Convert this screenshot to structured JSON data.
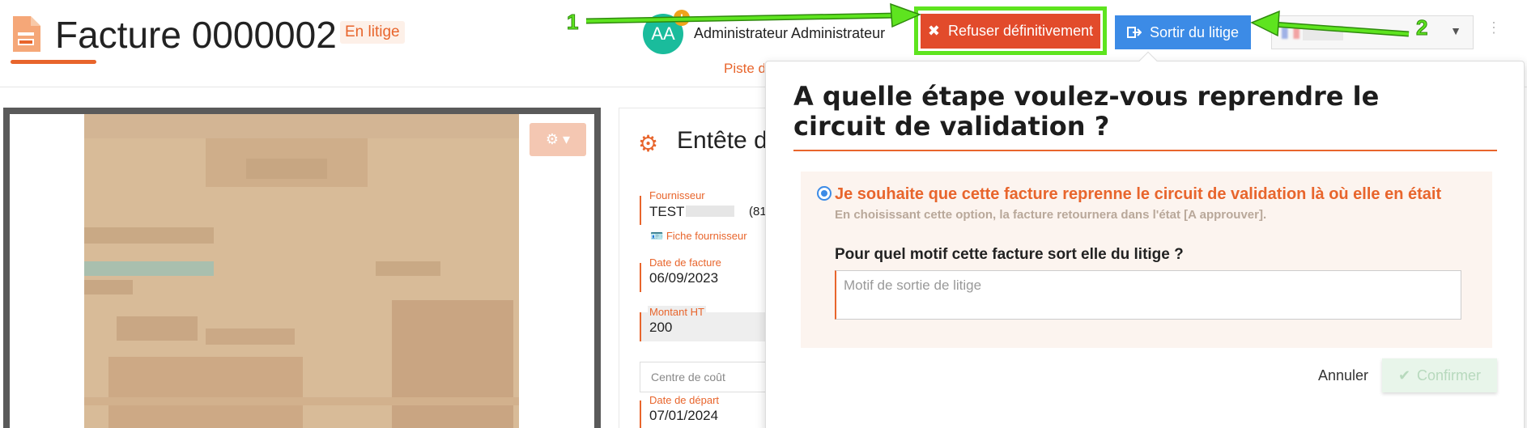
{
  "header": {
    "title": "Facture 0000002",
    "status": "En litige",
    "user_initials": "AA",
    "user_alert": "!",
    "user_name": "Administrateur Administrateur",
    "piste_link": "Piste d",
    "refuse_label": "Refuser définitivement",
    "sortir_label": "Sortir du litige",
    "annotation_1": "1",
    "annotation_2": "2"
  },
  "form": {
    "section_title": "Entête d",
    "fournisseur_label": "Fournisseur",
    "fournisseur_value": "TEST",
    "fournisseur_suffix": "(81",
    "fiche_fournisseur": "Fiche fournisseur",
    "date_facture_label": "Date de facture",
    "date_facture_value": "06/09/2023",
    "montant_label": "Montant HT",
    "montant_value": "200",
    "centre_placeholder": "Centre de coût",
    "date_depart_label": "Date de départ",
    "date_depart_value": "07/01/2024"
  },
  "modal": {
    "title": "A quelle étape voulez-vous reprendre le circuit de validation ?",
    "option_label": "Je souhaite que cette facture reprenne le circuit de validation là où elle en était",
    "option_hint": "En choisissant cette option, la facture retournera dans l'état [A approuver].",
    "motif_question": "Pour quel motif cette facture sort elle du litige ?",
    "motif_placeholder": "Motif de sortie de litige",
    "cancel_label": "Annuler",
    "confirm_label": "Confirmer"
  },
  "colors": {
    "accent": "#e8652c",
    "refuse": "#e24b2b",
    "primary": "#3c8be6",
    "annotation": "#5ee41f"
  },
  "icons": [
    "invoice-icon",
    "alert-icon",
    "close-icon",
    "exit-icon",
    "flag-icon",
    "chevron-down-icon",
    "kebab-icon",
    "gear-icon",
    "id-card-icon",
    "check-icon"
  ]
}
